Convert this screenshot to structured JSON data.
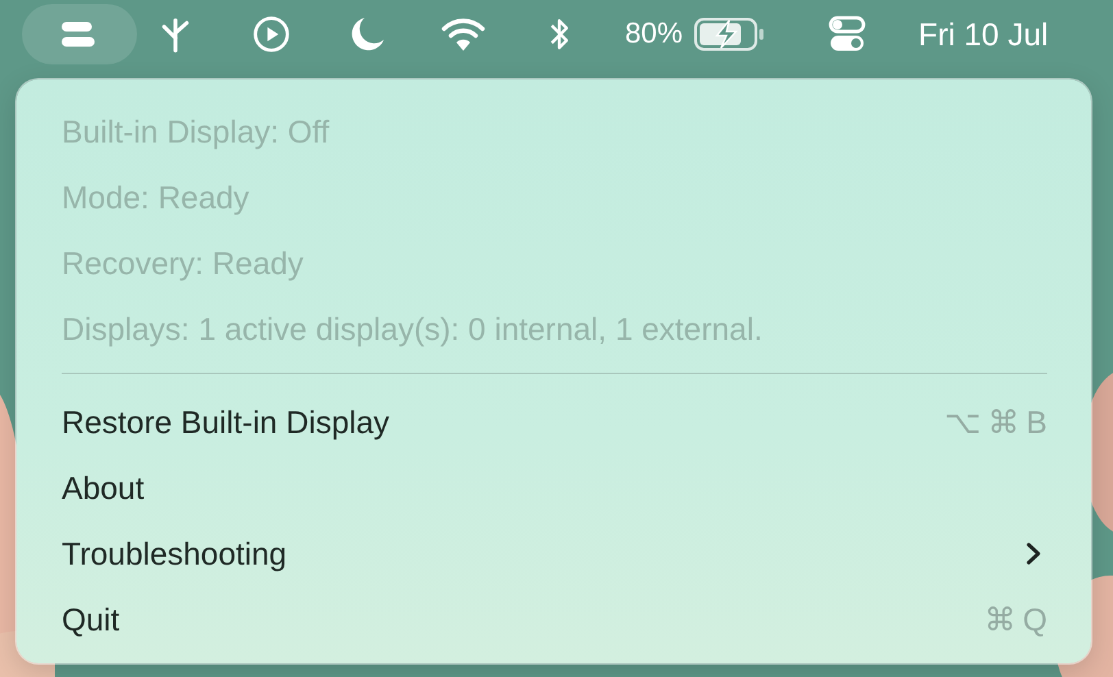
{
  "menu_bar": {
    "status_items": [
      {
        "kind": "app",
        "selected": true
      },
      {
        "kind": "fork",
        "selected": false
      },
      {
        "kind": "play",
        "selected": false
      },
      {
        "kind": "moon",
        "selected": false
      },
      {
        "kind": "wifi",
        "selected": false
      },
      {
        "kind": "bluetooth",
        "selected": false
      },
      {
        "kind": "battery",
        "label": "80%",
        "selected": false
      },
      {
        "kind": "control-center",
        "selected": false
      }
    ],
    "clock": "Fri 10 Jul"
  },
  "menu": {
    "items": [
      {
        "kind": "info",
        "label": "Built-in Display: Off",
        "disabled": true
      },
      {
        "kind": "info",
        "label": "Mode: Ready",
        "disabled": true
      },
      {
        "kind": "info",
        "label": "Recovery: Ready",
        "disabled": true
      },
      {
        "kind": "info",
        "label": "Displays: 1 active display(s): 0 internal, 1 external.",
        "disabled": true
      },
      {
        "kind": "separator"
      },
      {
        "kind": "action",
        "label": "Restore Built-in Display",
        "shortcut": "⌥⌘B",
        "disabled": false
      },
      {
        "kind": "action",
        "label": "About",
        "disabled": false
      },
      {
        "kind": "submenu",
        "label": "Troubleshooting",
        "disabled": false
      },
      {
        "kind": "action",
        "label": "Quit",
        "shortcut": "⌘Q",
        "disabled": false
      }
    ]
  }
}
